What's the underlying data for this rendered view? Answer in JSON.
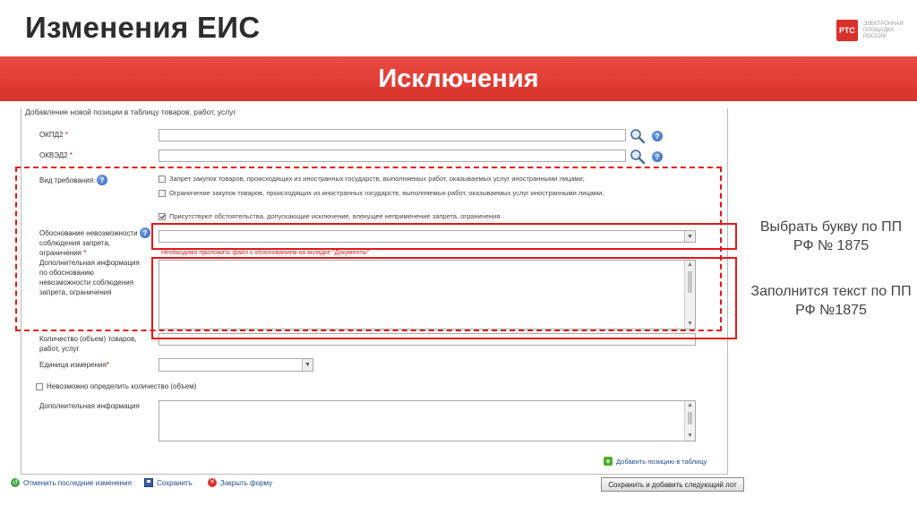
{
  "slide": {
    "title": "Изменения ЕИС",
    "subtitle": "Исключения",
    "logo_mark": "РТС",
    "logo_text": "ЭЛЕКТРОННАЯ ПЛОЩАДКА РОССИИ"
  },
  "form": {
    "header": "Добавление новой позиции в таблицу товаров, работ, услуг",
    "okpd2_label": "ОКПД2",
    "okved2_label": "ОКВЭД2",
    "required_mark": "*",
    "requirement_label": "Вид требования:",
    "options": [
      {
        "label": "Запрет закупок товаров, происходящих из иностранных государств, выполняемых работ, оказываемых услуг иностранными лицами;",
        "checked": false
      },
      {
        "label": "Ограничение закупок товаров, происходящих из иностранных государств, выполняемых работ, оказываемых услуг иностранными лицами;",
        "checked": false
      },
      {
        "label": "Присутствуют обстоятельства, допускающие исключение, влекущее неприменение запрета, ограничения",
        "checked": true
      }
    ],
    "justification_label": "Обоснование невозможности соблюдения запрета, ограничения",
    "justification_hint": "Необходимо приложить файл с обоснованием на вкладке \"Документы\"",
    "extra_justification_label": "Дополнительная информация по обоснованию невозможности соблюдения запрета, ограничения",
    "quantity_label": "Количество (объем) товаров, работ, услуг",
    "unit_label": "Единица измерения",
    "cannot_determine_label": "Невозможно определить количество (объем)",
    "extra_info_label": "Дополнительная информация",
    "add_to_table": "Добавить позицию в таблицу"
  },
  "footer": {
    "undo": "Отменить последние изменения",
    "save": "Сохранить",
    "close": "Закрыть форму",
    "save_next": "Сохранить и добавить следующий лот"
  },
  "notes": {
    "note1": "Выбрать букву по ПП РФ № 1875",
    "note2": "Заполнится текст по ПП РФ №1875"
  },
  "colors": {
    "banner": "#e0403a",
    "highlight": "#e2161b"
  }
}
